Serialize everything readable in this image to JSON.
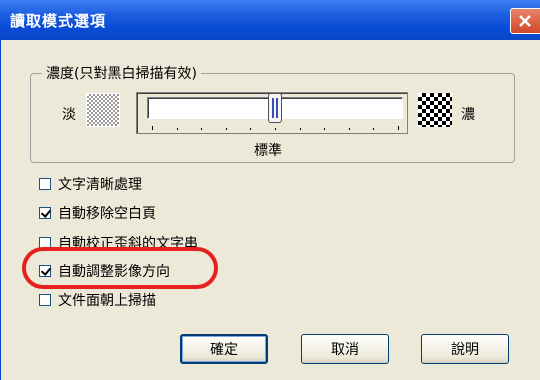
{
  "window": {
    "title": "讀取模式選項"
  },
  "density": {
    "group_label": "濃度(只對黑白掃描有效)",
    "light_label": "淡",
    "dark_label": "濃",
    "slider_position_label": "標準",
    "slider_level": 0.5
  },
  "options": [
    {
      "label": "文字清晰處理",
      "checked": false
    },
    {
      "label": "自動移除空白頁",
      "checked": true
    },
    {
      "label": "自動校正歪斜的文字串",
      "checked": false
    },
    {
      "label": "自動調整影像方向",
      "checked": true,
      "highlighted": true
    },
    {
      "label": "文件面朝上掃描",
      "checked": false
    }
  ],
  "buttons": {
    "ok": "確定",
    "cancel": "取消",
    "help": "說明"
  },
  "colors": {
    "titlebar": "#0a46c8",
    "highlight_ring": "#e81f1f",
    "dialog_bg": "#ece9d8"
  }
}
